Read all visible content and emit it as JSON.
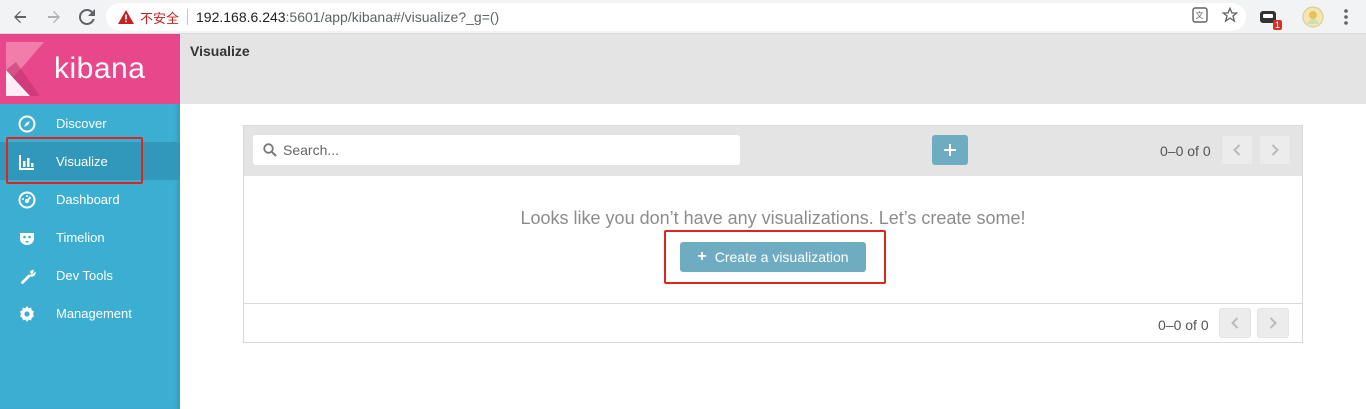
{
  "browser": {
    "security_label": "不安全",
    "url_host": "192.168.6.243",
    "url_rest": ":5601/app/kibana#/visualize?_g=()",
    "extension_badge": "1"
  },
  "app": {
    "logo_text": "kibana",
    "brand_color": "#e8488b",
    "sidebar_color": "#3caed2"
  },
  "sidebar": {
    "items": [
      {
        "label": "Discover",
        "icon": "compass-icon"
      },
      {
        "label": "Visualize",
        "icon": "bar-chart-icon",
        "active": true
      },
      {
        "label": "Dashboard",
        "icon": "gauge-icon"
      },
      {
        "label": "Timelion",
        "icon": "timelion-icon"
      },
      {
        "label": "Dev Tools",
        "icon": "wrench-icon"
      },
      {
        "label": "Management",
        "icon": "gear-icon"
      }
    ]
  },
  "header": {
    "title": "Visualize"
  },
  "listing": {
    "search_placeholder": "Search...",
    "count_top": "0–0 of 0",
    "count_bottom": "0–0 of 0",
    "empty_message": "Looks like you don’t have any visualizations. Let’s create some!",
    "create_button_label": "Create a visualization"
  }
}
